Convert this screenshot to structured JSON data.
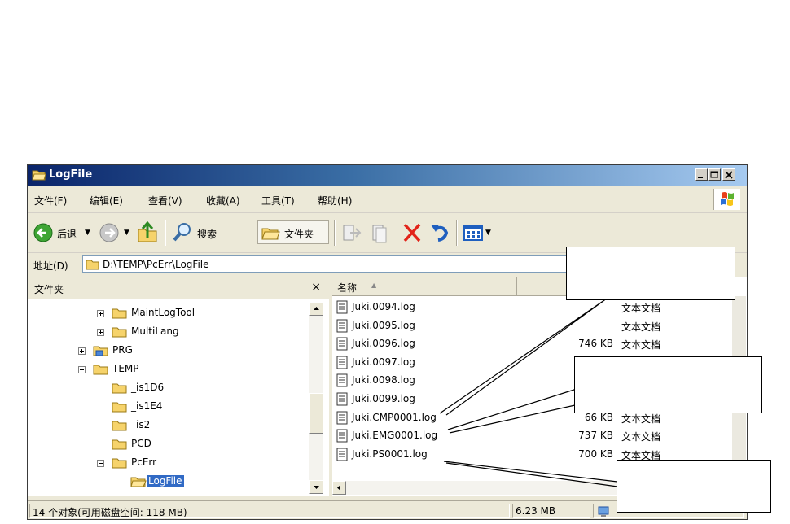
{
  "window": {
    "title": "LogFile",
    "controls": [
      "minimize",
      "maximize",
      "close"
    ]
  },
  "menu": [
    "文件(F)",
    "编辑(E)",
    "查看(V)",
    "收藏(A)",
    "工具(T)",
    "帮助(H)"
  ],
  "toolbar": {
    "back_label": "后退",
    "search_label": "搜索",
    "folders_label": "文件夹"
  },
  "address": {
    "label": "地址(D)",
    "path": "D:\\TEMP\\PcErr\\LogFile"
  },
  "folders_pane": {
    "title": "文件夹",
    "close": "×",
    "tree": [
      {
        "label": "MaintLogTool",
        "expander": "plus",
        "indent": 2,
        "icon": "folder"
      },
      {
        "label": "MultiLang",
        "expander": "plus",
        "indent": 2,
        "icon": "folder"
      },
      {
        "label": "PRG",
        "expander": "plus",
        "indent": 1,
        "icon": "network-folder"
      },
      {
        "label": "TEMP",
        "expander": "minus",
        "indent": 1,
        "icon": "folder"
      },
      {
        "label": "_is1D6",
        "expander": "none",
        "indent": 2,
        "icon": "folder"
      },
      {
        "label": "_is1E4",
        "expander": "none",
        "indent": 2,
        "icon": "folder"
      },
      {
        "label": "_is2",
        "expander": "none",
        "indent": 2,
        "icon": "folder"
      },
      {
        "label": "PCD",
        "expander": "none",
        "indent": 2,
        "icon": "folder"
      },
      {
        "label": "PcErr",
        "expander": "minus",
        "indent": 2,
        "icon": "folder"
      },
      {
        "label": "LogFile",
        "expander": "none",
        "indent": 3,
        "icon": "open-folder",
        "selected": true
      }
    ]
  },
  "files_pane": {
    "columns": [
      "名称",
      "",
      ""
    ],
    "files": [
      {
        "name": "Juki.0094.log",
        "size": "",
        "type": "文本文档"
      },
      {
        "name": "Juki.0095.log",
        "size": "",
        "type": "文本文档"
      },
      {
        "name": "Juki.0096.log",
        "size": "746 KB",
        "type": "文本文档"
      },
      {
        "name": "Juki.0097.log",
        "size": "",
        "type": ""
      },
      {
        "name": "Juki.0098.log",
        "size": "",
        "type": ""
      },
      {
        "name": "Juki.0099.log",
        "size": "",
        "type": ""
      },
      {
        "name": "Juki.CMP0001.log",
        "size": "66 KB",
        "type": "文本文档"
      },
      {
        "name": "Juki.EMG0001.log",
        "size": "737 KB",
        "type": "文本文档"
      },
      {
        "name": "Juki.PS0001.log",
        "size": "700 KB",
        "type": "文本文档"
      }
    ]
  },
  "status": {
    "objects": "14 个对象(可用磁盘空间: 118 MB)",
    "size": "6.23 MB"
  },
  "callouts": [
    "",
    "",
    ""
  ],
  "colors": {
    "title_start": "#0a246a",
    "title_end": "#a6caf0",
    "chrome": "#ece9d8",
    "selection": "#316ac5"
  }
}
